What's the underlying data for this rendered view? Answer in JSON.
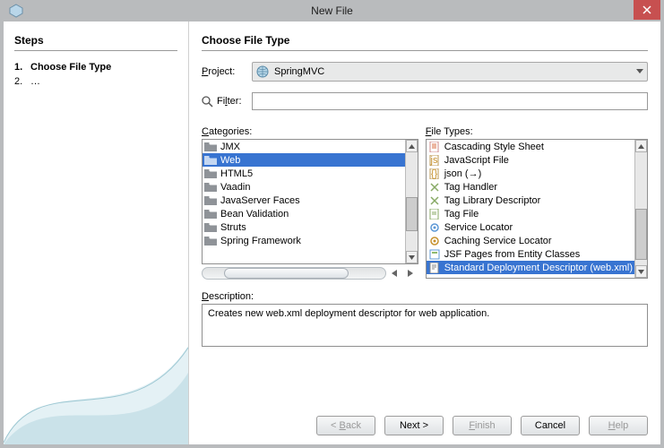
{
  "title": "New File",
  "steps": {
    "heading": "Steps",
    "items": [
      {
        "num": "1.",
        "label": "Choose File Type",
        "current": true
      },
      {
        "num": "2.",
        "label": "…",
        "current": false
      }
    ]
  },
  "main": {
    "heading": "Choose File Type",
    "project": {
      "label": "Project:",
      "value": "SpringMVC"
    },
    "filter": {
      "label": "Filter:",
      "value": ""
    },
    "categories": {
      "label": "Categories:",
      "items": [
        "JMX",
        "Web",
        "HTML5",
        "Vaadin",
        "JavaServer Faces",
        "Bean Validation",
        "Struts",
        "Spring Framework"
      ],
      "selectedIndex": 1
    },
    "fileTypes": {
      "label": "File Types:",
      "items": [
        "Cascading Style Sheet",
        "JavaScript File",
        "json (→)",
        "Tag Handler",
        "Tag Library Descriptor",
        "Tag File",
        "Service Locator",
        "Caching Service Locator",
        "JSF Pages from Entity Classes",
        "Standard Deployment Descriptor (web.xml)"
      ],
      "selectedIndex": 9
    },
    "description": {
      "label": "Description:",
      "text": "Creates new web.xml deployment descriptor for web application."
    }
  },
  "buttons": {
    "back": "< Back",
    "next": "Next >",
    "finish": "Finish",
    "cancel": "Cancel",
    "help": "Help"
  }
}
